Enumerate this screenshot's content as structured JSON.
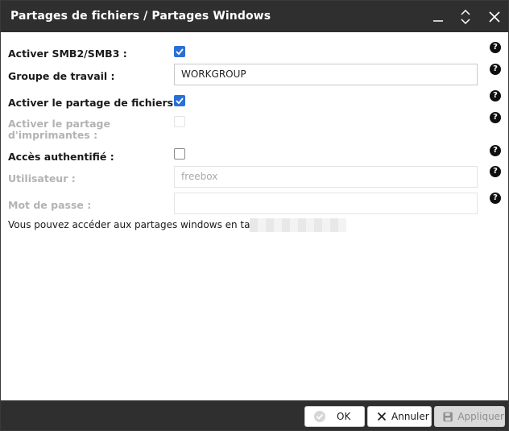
{
  "window": {
    "title": "Partages de fichiers / Partages Windows"
  },
  "form": {
    "smb_label": "Activer SMB2/SMB3 :",
    "smb_checked": true,
    "workgroup_label": "Groupe de travail :",
    "workgroup_value": "WORKGROUP",
    "file_sharing_label": "Activer le partage de fichiers :",
    "file_sharing_checked": true,
    "printer_sharing_label_line1": "Activer le partage",
    "printer_sharing_label_line2": "d'imprimantes :",
    "printer_sharing_checked": false,
    "auth_label": "Accès authentifié :",
    "auth_checked": false,
    "user_label": "Utilisateur :",
    "user_placeholder": "freebox",
    "password_label": "Mot de passe :",
    "password_value": ""
  },
  "info_text": "Vous pouvez accéder aux partages windows en tapant",
  "footer": {
    "ok_label": "OK",
    "cancel_label": "Annuler",
    "apply_label": "Appliquer"
  },
  "icons": {
    "help": "question-circle-icon",
    "minimize": "minimize-icon",
    "maximize": "expand-icon",
    "close": "close-icon",
    "ok": "check-circle-icon",
    "cancel": "x-icon",
    "apply": "floppy-disk-icon"
  },
  "colors": {
    "titlebar": "#2f2f2f",
    "checkbox_checked": "#2a6fd6",
    "footer": "#2f2f2f"
  }
}
